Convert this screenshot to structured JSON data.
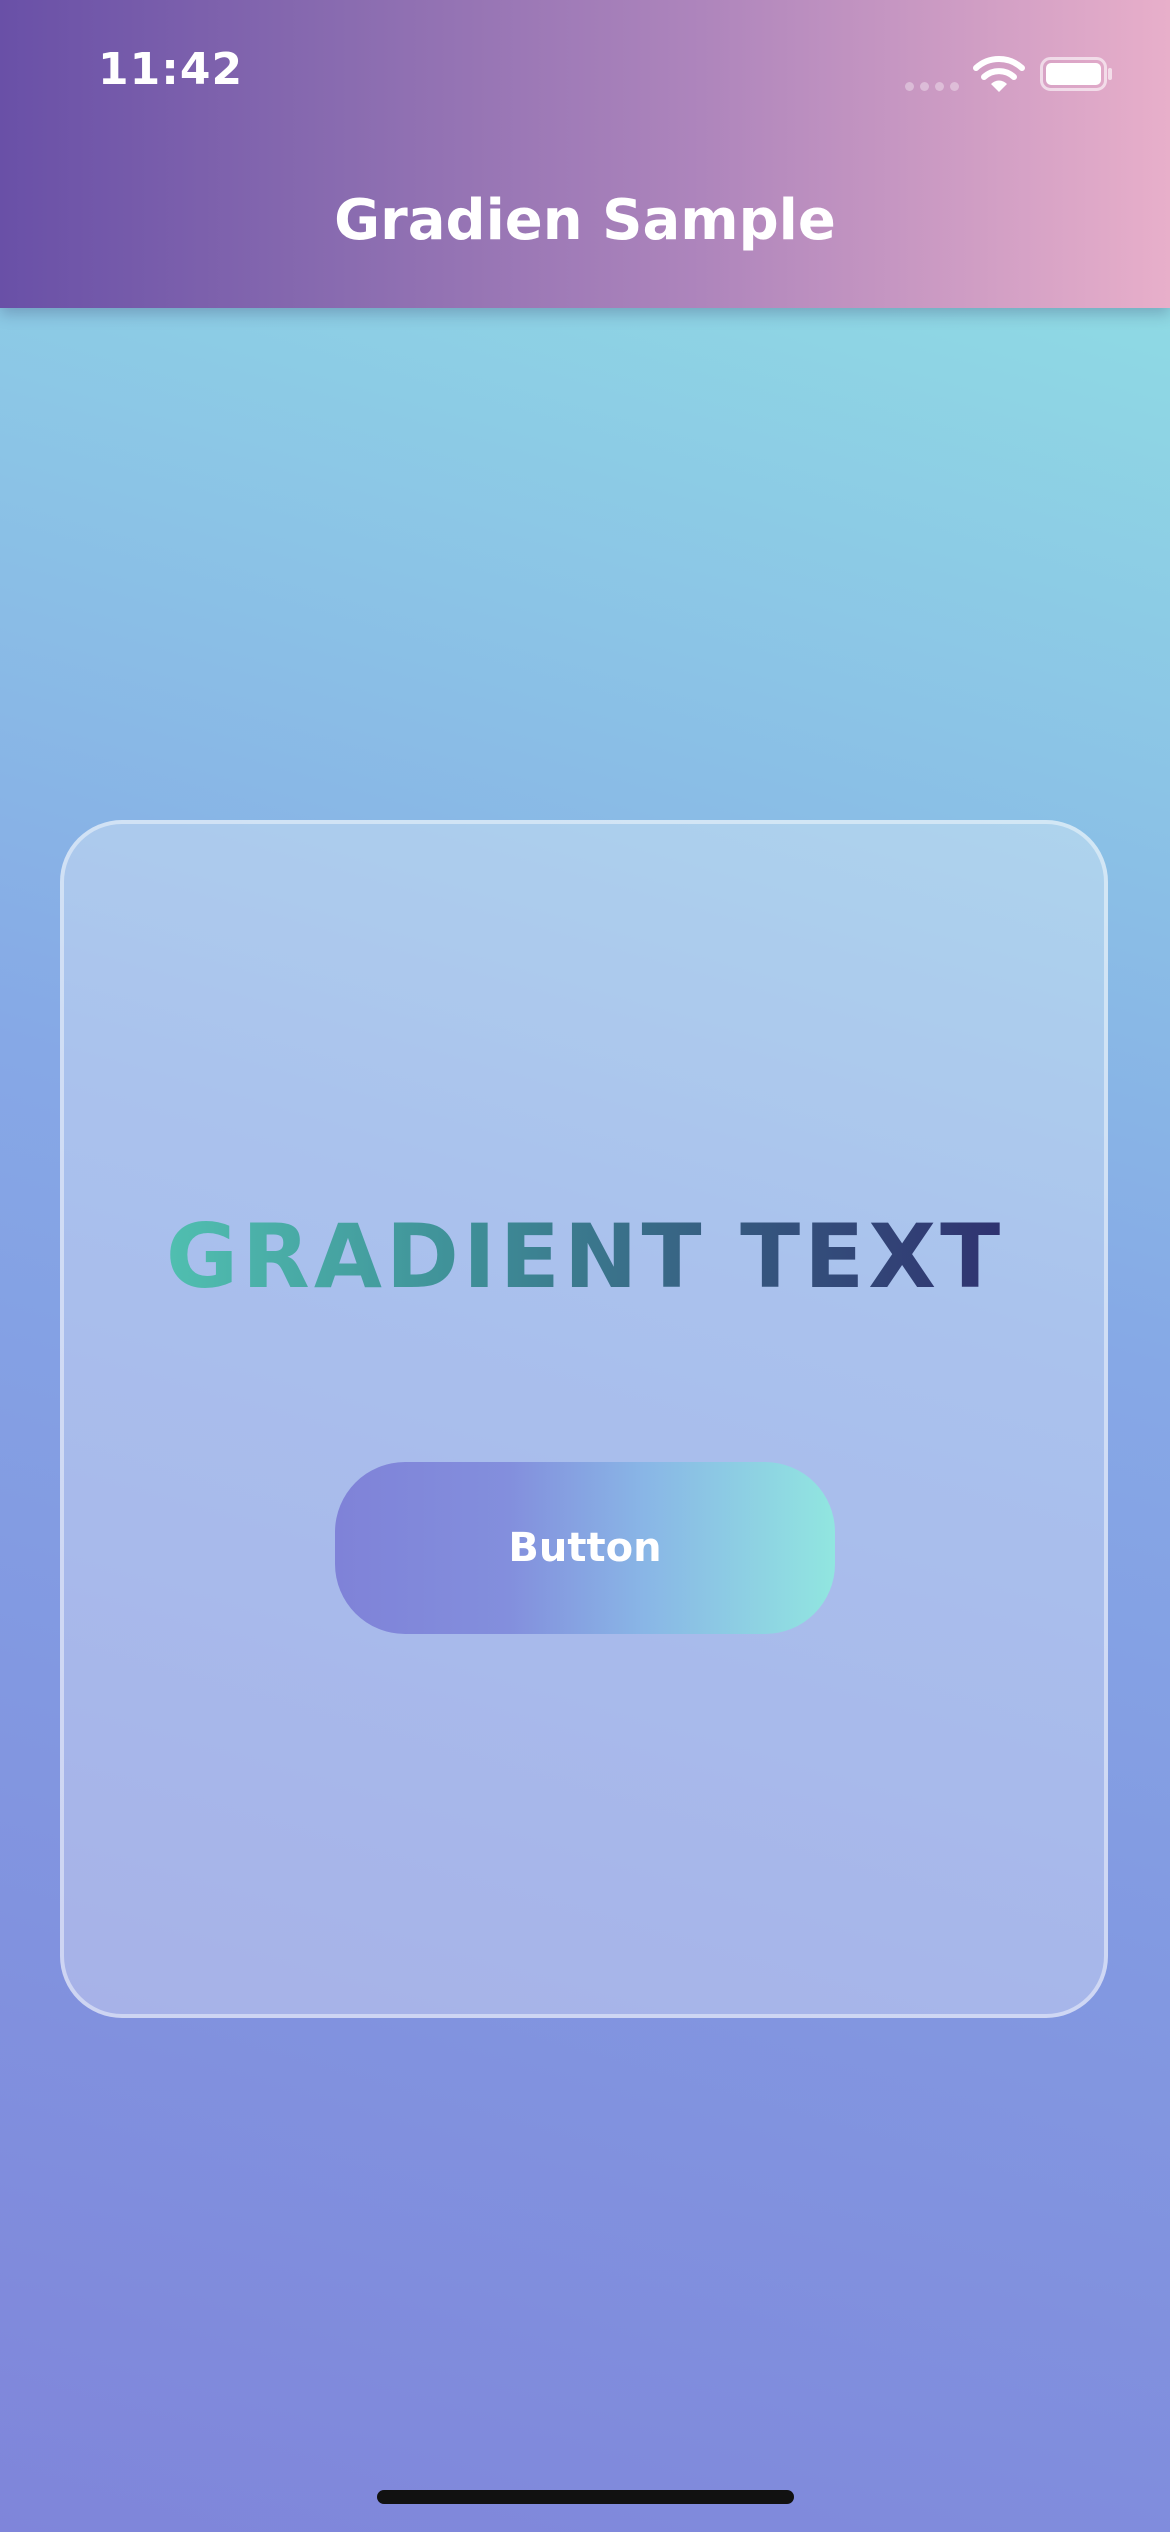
{
  "status_bar": {
    "time": "11:42",
    "icons": [
      "cellular-signal-icon",
      "wifi-icon",
      "battery-icon"
    ]
  },
  "header": {
    "title": "Gradien Sample",
    "gradient": [
      "#6950A7",
      "#8A6CB0",
      "#AE85BC",
      "#E8AFCA"
    ]
  },
  "background": {
    "gradient": [
      "#91E8E2",
      "#8BC3E6",
      "#86A8E6",
      "#8298E1",
      "#7F85DA"
    ]
  },
  "card": {
    "heading": "GRADIENT TEXT",
    "heading_gradient": [
      "#50BFB0",
      "#3E8C96",
      "#35567E",
      "#2F3270"
    ],
    "button": {
      "label": "Button",
      "gradient": [
        "#7F82D8",
        "#838FDD",
        "#89B6E6",
        "#91E6E0"
      ]
    }
  }
}
